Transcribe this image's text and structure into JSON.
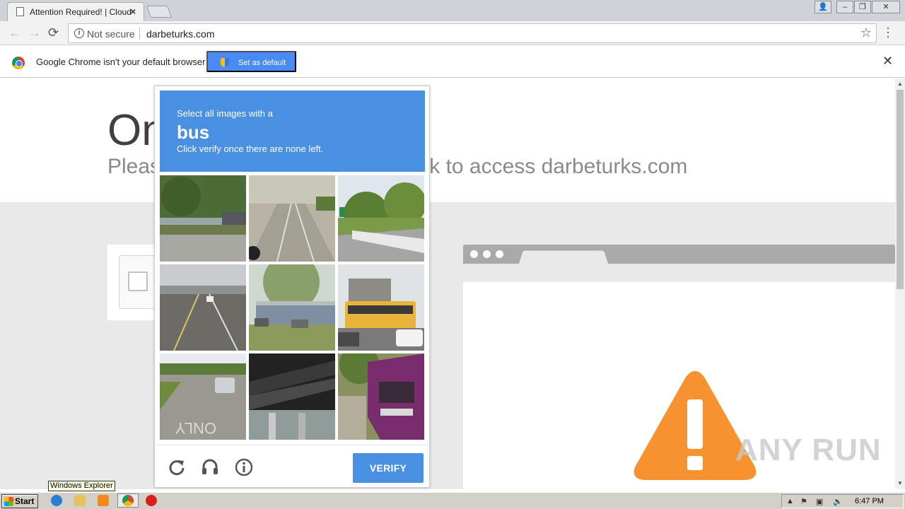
{
  "browser": {
    "tab_title": "Attention Required! | Cloudflare",
    "url_security": "Not secure",
    "url": "darbeturks.com"
  },
  "infobar": {
    "message": "Google Chrome isn't your default browser",
    "button_label": "Set as default"
  },
  "page": {
    "heading": "One more step",
    "subheading": "Please complete the security check to access darbeturks.com"
  },
  "captcha": {
    "instruction_line1": "Select all images with a",
    "target_object": "bus",
    "instruction_line2": "Click verify once there are none left.",
    "verify_label": "VERIFY",
    "tiles": [
      {
        "scene": "street with trees and houses"
      },
      {
        "scene": "empty highway lanes"
      },
      {
        "scene": "bridge railing with trees"
      },
      {
        "scene": "highway with cars"
      },
      {
        "scene": "parking lot with building"
      },
      {
        "scene": "yellow school bus"
      },
      {
        "scene": "road with only marking and suv"
      },
      {
        "scene": "underside of overpass"
      },
      {
        "scene": "purple city bus"
      }
    ]
  },
  "watermark": "ANY RUN",
  "taskbar": {
    "start_label": "Start",
    "tooltip": "Windows Explorer",
    "clock": "6:47 PM"
  },
  "colors": {
    "captcha_blue": "#4a90e2",
    "warning_orange": "#f6922f",
    "chrome_button_blue": "#4a8af4"
  }
}
